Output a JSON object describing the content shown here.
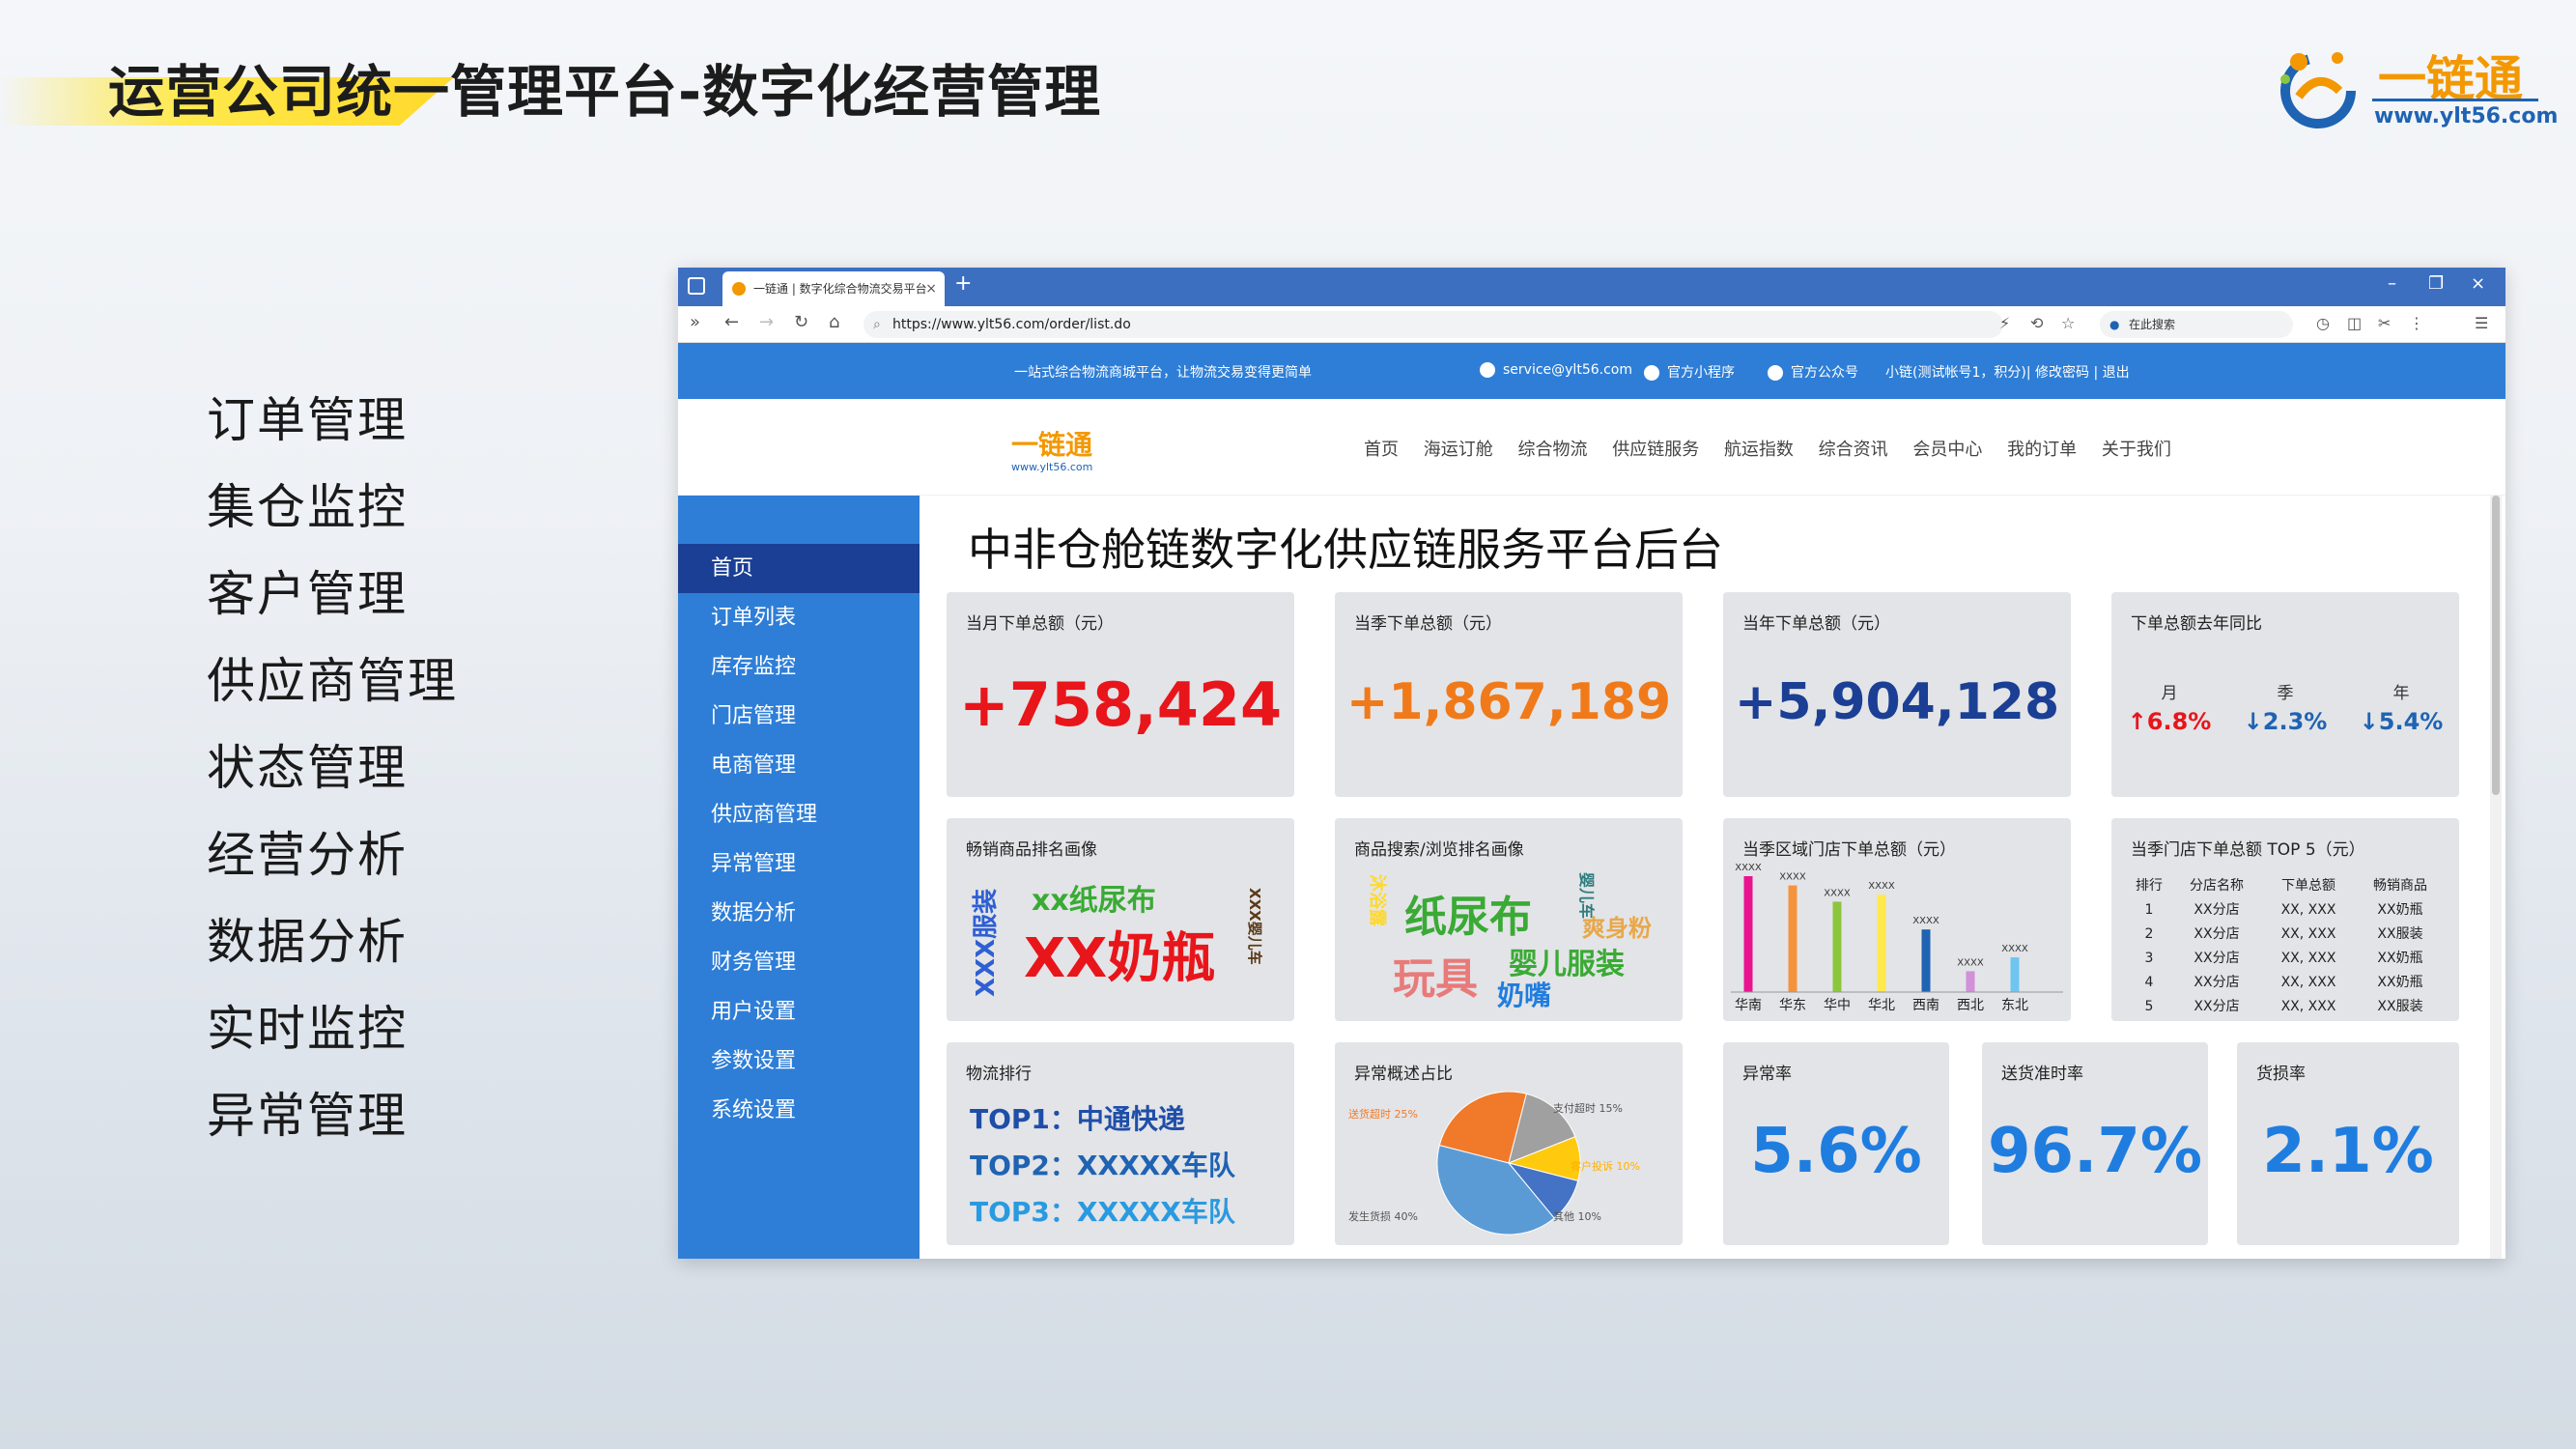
{
  "slide": {
    "title": "运营公司统一管理平台-数字化经营管理",
    "brand_name": "一链通",
    "brand_url": "www.ylt56.com",
    "menu": [
      "订单管理",
      "集仓监控",
      "客户管理",
      "供应商管理",
      "状态管理",
      "经营分析",
      "数据分析",
      "实时监控",
      "异常管理"
    ]
  },
  "browser": {
    "tab_title": "一链通 | 数字化综合物流交易平台",
    "url": "https://www.ylt56.com/order/list.do",
    "search_placeholder": "在此搜索"
  },
  "site": {
    "slogan": "一站式综合物流商城平台，让物流交易变得更简单",
    "email": "service@ylt56.com",
    "mini_program": "官方小程序",
    "official_account": "官方公众号",
    "user_info": "小链(测试帐号1，积分)| 修改密码 | 退出",
    "logo_cn": "一链通",
    "logo_en": "www.ylt56.com",
    "nav": [
      "首页",
      "海运订舱",
      "综合物流",
      "供应链服务",
      "航运指数",
      "综合资讯",
      "会员中心",
      "我的订单",
      "关于我们"
    ]
  },
  "sidebar": [
    "首页",
    "订单列表",
    "库存监控",
    "门店管理",
    "电商管理",
    "供应商管理",
    "异常管理",
    "数据分析",
    "财务管理",
    "用户设置",
    "参数设置",
    "系统设置"
  ],
  "dashboard": {
    "title": "中非仓舱链数字化供应链服务平台后台",
    "monthly": {
      "label": "当月下单总额（元）",
      "value": "+758,424",
      "color": "#e8151b"
    },
    "quarterly": {
      "label": "当季下单总额（元）",
      "value": "+1,867,189",
      "color": "#f07a1a"
    },
    "yearly": {
      "label": "当年下单总额（元）",
      "value": "+5,904,128",
      "color": "#1b3f94"
    },
    "yoy": {
      "label": "下单总额去年同比",
      "headers": [
        "月",
        "季",
        "年"
      ],
      "values": [
        "↑6.8%",
        "↓2.3%",
        "↓5.4%"
      ],
      "colors": [
        "#e8151b",
        "#1f63b3",
        "#1f63b3"
      ]
    },
    "bestseller": {
      "label": "畅销商品排名画像",
      "words": [
        "xx纸尿布",
        "XX奶瓶",
        "XXX服装",
        "XXX婴儿车"
      ]
    },
    "search_rank": {
      "label": "商品搜索/浏览排名画像",
      "words": [
        "纸尿布",
        "玩具",
        "婴儿服装",
        "奶嘴",
        "爽身粉",
        "沐浴露",
        "婴儿车"
      ]
    },
    "region_chart": {
      "label": "当季区域门店下单总额（元）"
    },
    "top5": {
      "label": "当季门店下单总额 TOP 5（元）",
      "headers": [
        "排行",
        "分店名称",
        "下单总额",
        "畅销商品"
      ],
      "rows": [
        [
          "1",
          "XX分店",
          "XX, XXX",
          "XX奶瓶"
        ],
        [
          "2",
          "XX分店",
          "XX, XXX",
          "XX服装"
        ],
        [
          "3",
          "XX分店",
          "XX, XXX",
          "XX奶瓶"
        ],
        [
          "4",
          "XX分店",
          "XX, XXX",
          "XX奶瓶"
        ],
        [
          "5",
          "XX分店",
          "XX, XXX",
          "XX服装"
        ]
      ]
    },
    "logistics": {
      "label": "物流排行",
      "lines": [
        "TOP1：中通快递",
        "TOP2：XXXXX车队",
        "TOP3：XXXXX车队"
      ]
    },
    "exceptions": {
      "label": "异常概述占比"
    },
    "exception_rate": {
      "label": "异常率",
      "value": "5.6%"
    },
    "ontime_rate": {
      "label": "送货准时率",
      "value": "96.7%"
    },
    "damage_rate": {
      "label": "货损率",
      "value": "2.1%"
    }
  },
  "chart_data": [
    {
      "type": "bar",
      "categories": [
        "华南",
        "华东",
        "华中",
        "华北",
        "西南",
        "西北",
        "东北"
      ],
      "values": [
        100,
        92,
        78,
        84,
        54,
        18,
        30
      ],
      "data_labels": [
        "XXXX",
        "XXXX",
        "XXXX",
        "XXXX",
        "XXXX",
        "XXXX",
        "XXXX"
      ],
      "colors": [
        "#e8158f",
        "#f5923e",
        "#8cc63f",
        "#ffe94d",
        "#1f63b3",
        "#d291d8",
        "#6ec6f0"
      ],
      "title": "当季区域门店下单总额（元）",
      "ylim": [
        0,
        100
      ]
    },
    {
      "type": "pie",
      "labels": [
        "送货超时",
        "支付超时",
        "客户投诉",
        "其他",
        "发生货损"
      ],
      "values": [
        25,
        15,
        10,
        10,
        40
      ],
      "label_texts": [
        "送货超时 25%",
        "支付超时 15%",
        "客户投诉 10%",
        "其他 10%",
        "发生货损 40%"
      ],
      "colors": [
        "#f07a2a",
        "#a0a0a0",
        "#ffc90e",
        "#4472c4",
        "#5b9bd5"
      ],
      "title": "异常概述占比"
    }
  ]
}
